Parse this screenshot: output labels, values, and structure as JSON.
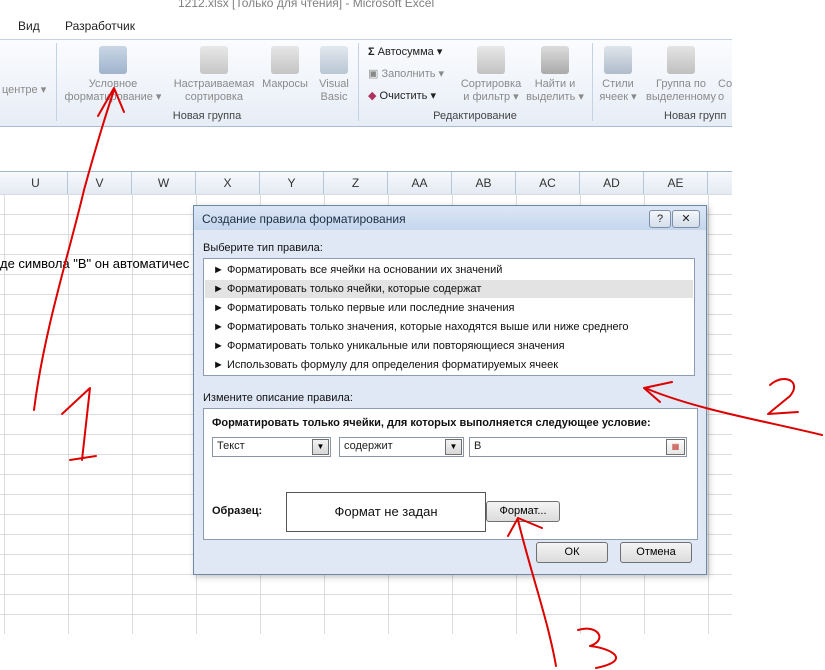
{
  "window": {
    "title": "1212.xlsx [Только для чтения] - Microsoft Excel"
  },
  "tabs": [
    "Вид",
    "Разработчик"
  ],
  "ribbon": {
    "center_label": "центре",
    "buttons": [
      {
        "l1": "Условное",
        "l2": "форматирование ▾"
      },
      {
        "l1": "Настраиваемая",
        "l2": "сортировка"
      },
      {
        "l1": "Макросы",
        "l2": ""
      },
      {
        "l1": "Visual",
        "l2": "Basic"
      },
      {
        "l1": "Сортировка",
        "l2": "и фильтр ▾"
      },
      {
        "l1": "Найти и",
        "l2": "выделить ▾"
      },
      {
        "l1": "Стили",
        "l2": "ячеек ▾"
      },
      {
        "l1": "Группа по",
        "l2": "выделенному"
      },
      {
        "l1": "Со",
        "l2": "о"
      }
    ],
    "autosum": "Автосумма ▾",
    "fill": "Заполнить ▾",
    "clear": "Очистить ▾",
    "groups": [
      "Новая группа",
      "Редактирование",
      "Новая групп"
    ]
  },
  "sheet": {
    "columns": [
      "U",
      "V",
      "W",
      "X",
      "Y",
      "Z",
      "AA",
      "AB",
      "AC",
      "AD",
      "AE"
    ],
    "cell_text": "де символа \"В\" он автоматичес"
  },
  "dialog": {
    "title": "Создание правила форматирования",
    "help": "?",
    "close": "✕",
    "type_label": "Выберите тип правила:",
    "rule_types": [
      "► Форматировать все ячейки на основании их значений",
      "► Форматировать только ячейки, которые содержат",
      "► Форматировать только первые или последние значения",
      "► Форматировать только значения, которые находятся выше или ниже среднего",
      "► Форматировать только уникальные или повторяющиеся значения",
      "► Использовать формулу для определения форматируемых ячеек"
    ],
    "selected_index": 1,
    "edit_label": "Измените описание правила:",
    "condition_title": "Форматировать только ячейки, для которых выполняется следующее условие:",
    "combo1": "Текст",
    "combo2": "содержит",
    "value": "В",
    "sample_label": "Образец:",
    "sample_text": "Формат не задан",
    "format_button": "Формат...",
    "ok": "ОК",
    "cancel": "Отмена"
  },
  "annotations": [
    "1",
    "2",
    "3"
  ],
  "colors": {
    "annotation": "#dd0000",
    "ribbon_bg": "#e7edf6",
    "dialog_bg": "#dfe8f4",
    "selected_row": "#e3e3e3"
  }
}
